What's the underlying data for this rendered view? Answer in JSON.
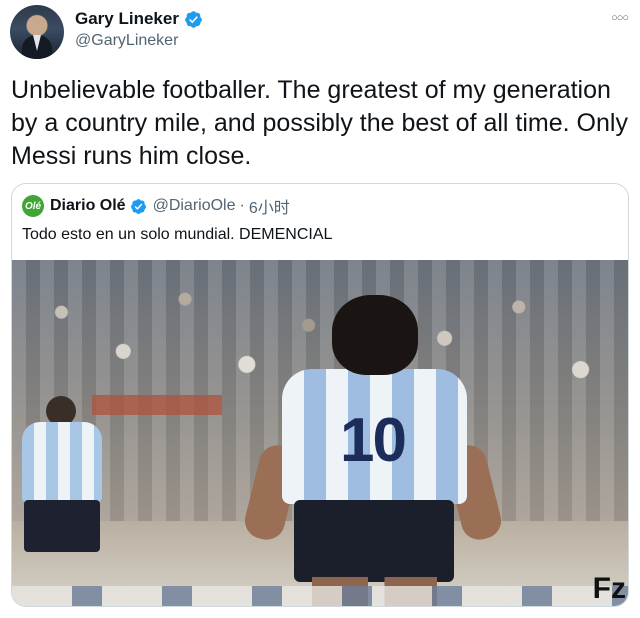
{
  "tweet": {
    "author": {
      "display_name": "Gary Lineker",
      "handle": "@GaryLineker",
      "verified": true
    },
    "more_icon": "more-horizontal-icon",
    "text": "Unbelievable footballer. The greatest of my generation by a country mile, and possibly the best of all time. Only Messi runs him close."
  },
  "quoted_tweet": {
    "logo_text": "Olé",
    "display_name": "Diario Olé",
    "handle": "@DiarioOle",
    "separator": "·",
    "time": "6小时",
    "verified": true,
    "text": "Todo esto en un solo mundial. DEMENCIAL",
    "media": {
      "jersey_number": "10",
      "watermark": "Fz"
    }
  },
  "colors": {
    "verified_blue": "#1d9bf0",
    "text_primary": "#0f1419",
    "text_secondary": "#536471",
    "border": "#cfd9de",
    "ole_green": "#3fa535"
  }
}
